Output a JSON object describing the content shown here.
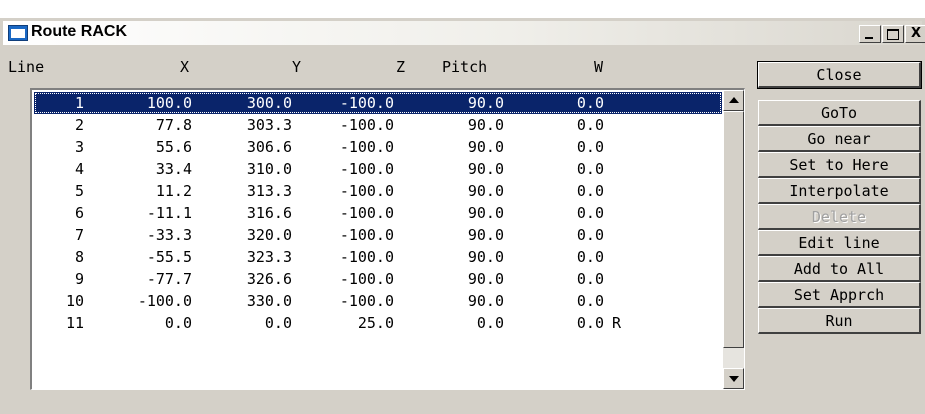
{
  "window": {
    "title": "Route RACK",
    "controls": {
      "minimize": "_",
      "maximize": "□",
      "close": "X"
    }
  },
  "table": {
    "columns": [
      "Line",
      "X",
      "Y",
      "Z",
      "Pitch",
      "W"
    ],
    "rows": [
      {
        "line": "1",
        "x": "100.0",
        "y": "300.0",
        "z": "-100.0",
        "pitch": "90.0",
        "w": "0.0",
        "flag": "",
        "selected": true
      },
      {
        "line": "2",
        "x": "77.8",
        "y": "303.3",
        "z": "-100.0",
        "pitch": "90.0",
        "w": "0.0",
        "flag": "",
        "selected": false
      },
      {
        "line": "3",
        "x": "55.6",
        "y": "306.6",
        "z": "-100.0",
        "pitch": "90.0",
        "w": "0.0",
        "flag": "",
        "selected": false
      },
      {
        "line": "4",
        "x": "33.4",
        "y": "310.0",
        "z": "-100.0",
        "pitch": "90.0",
        "w": "0.0",
        "flag": "",
        "selected": false
      },
      {
        "line": "5",
        "x": "11.2",
        "y": "313.3",
        "z": "-100.0",
        "pitch": "90.0",
        "w": "0.0",
        "flag": "",
        "selected": false
      },
      {
        "line": "6",
        "x": "-11.1",
        "y": "316.6",
        "z": "-100.0",
        "pitch": "90.0",
        "w": "0.0",
        "flag": "",
        "selected": false
      },
      {
        "line": "7",
        "x": "-33.3",
        "y": "320.0",
        "z": "-100.0",
        "pitch": "90.0",
        "w": "0.0",
        "flag": "",
        "selected": false
      },
      {
        "line": "8",
        "x": "-55.5",
        "y": "323.3",
        "z": "-100.0",
        "pitch": "90.0",
        "w": "0.0",
        "flag": "",
        "selected": false
      },
      {
        "line": "9",
        "x": "-77.7",
        "y": "326.6",
        "z": "-100.0",
        "pitch": "90.0",
        "w": "0.0",
        "flag": "",
        "selected": false
      },
      {
        "line": "10",
        "x": "-100.0",
        "y": "330.0",
        "z": "-100.0",
        "pitch": "90.0",
        "w": "0.0",
        "flag": "",
        "selected": false
      },
      {
        "line": "11",
        "x": "0.0",
        "y": "0.0",
        "z": "25.0",
        "pitch": "0.0",
        "w": "0.0",
        "flag": "R",
        "selected": false
      }
    ]
  },
  "buttons": [
    {
      "id": "close",
      "label": "Close",
      "enabled": true,
      "default": true
    },
    {
      "id": "goto",
      "label": "GoTo",
      "enabled": true,
      "default": false
    },
    {
      "id": "go-near",
      "label": "Go near",
      "enabled": true,
      "default": false
    },
    {
      "id": "set-to-here",
      "label": "Set to Here",
      "enabled": true,
      "default": false
    },
    {
      "id": "interpolate",
      "label": "Interpolate",
      "enabled": true,
      "default": false
    },
    {
      "id": "delete",
      "label": "Delete",
      "enabled": false,
      "default": false
    },
    {
      "id": "edit-line",
      "label": "Edit line",
      "enabled": true,
      "default": false
    },
    {
      "id": "add-to-all",
      "label": "Add to All",
      "enabled": true,
      "default": false
    },
    {
      "id": "set-apprch",
      "label": "Set Apprch",
      "enabled": true,
      "default": false
    },
    {
      "id": "run",
      "label": "Run",
      "enabled": true,
      "default": false
    }
  ],
  "colors": {
    "selection": "#0a246a",
    "face": "#d4d0c8",
    "disabled_text": "#a0a0a0"
  },
  "icons": {
    "title": "window-icon",
    "scroll_up": "scroll-up-arrow-icon",
    "scroll_down": "scroll-down-arrow-icon"
  }
}
